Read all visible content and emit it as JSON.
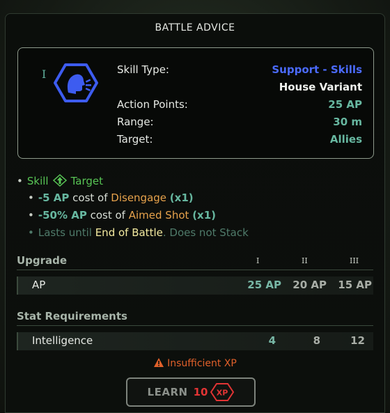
{
  "title": "BATTLE ADVICE",
  "skill": {
    "tier_mark": "I",
    "icon": "support-shout-icon",
    "rows": [
      {
        "label": "Skill Type:",
        "value": "Support - Skills"
      },
      {
        "label": "",
        "value": "House Variant"
      },
      {
        "label": "Action Points:",
        "value": "25 AP"
      },
      {
        "label": "Range:",
        "value": "30 m"
      },
      {
        "label": "Target:",
        "value": "Allies"
      }
    ]
  },
  "effects": {
    "header": {
      "skill": "Skill",
      "target": "Target"
    },
    "line1": {
      "amount": "-5 AP",
      "cost_of": "cost of",
      "name": "Disengage",
      "mult": "(x1)"
    },
    "line2": {
      "amount": "-50% AP",
      "cost_of": "cost of",
      "name": "Aimed Shot",
      "mult": "(x1)"
    },
    "line3": {
      "lasts": "Lasts until",
      "until": "End of Battle",
      "stack": ". Does not Stack"
    }
  },
  "upgrade": {
    "heading": "Upgrade",
    "tiers": [
      "I",
      "II",
      "III"
    ],
    "row_label": "AP",
    "values": [
      "25 AP",
      "20 AP",
      "15 AP"
    ]
  },
  "requirements": {
    "heading": "Stat Requirements",
    "row_label": "Intelligence",
    "values": [
      "4",
      "8",
      "12"
    ]
  },
  "warning": "Insufficient XP",
  "learn": {
    "label": "LEARN",
    "cost": "10",
    "badge": "XP"
  },
  "colors": {
    "accent_blue": "#4b6bff",
    "teal": "#67b7a0",
    "green": "#58c455",
    "orange": "#e7a24c",
    "warning": "#e0602a",
    "xp_red": "#e23434"
  }
}
